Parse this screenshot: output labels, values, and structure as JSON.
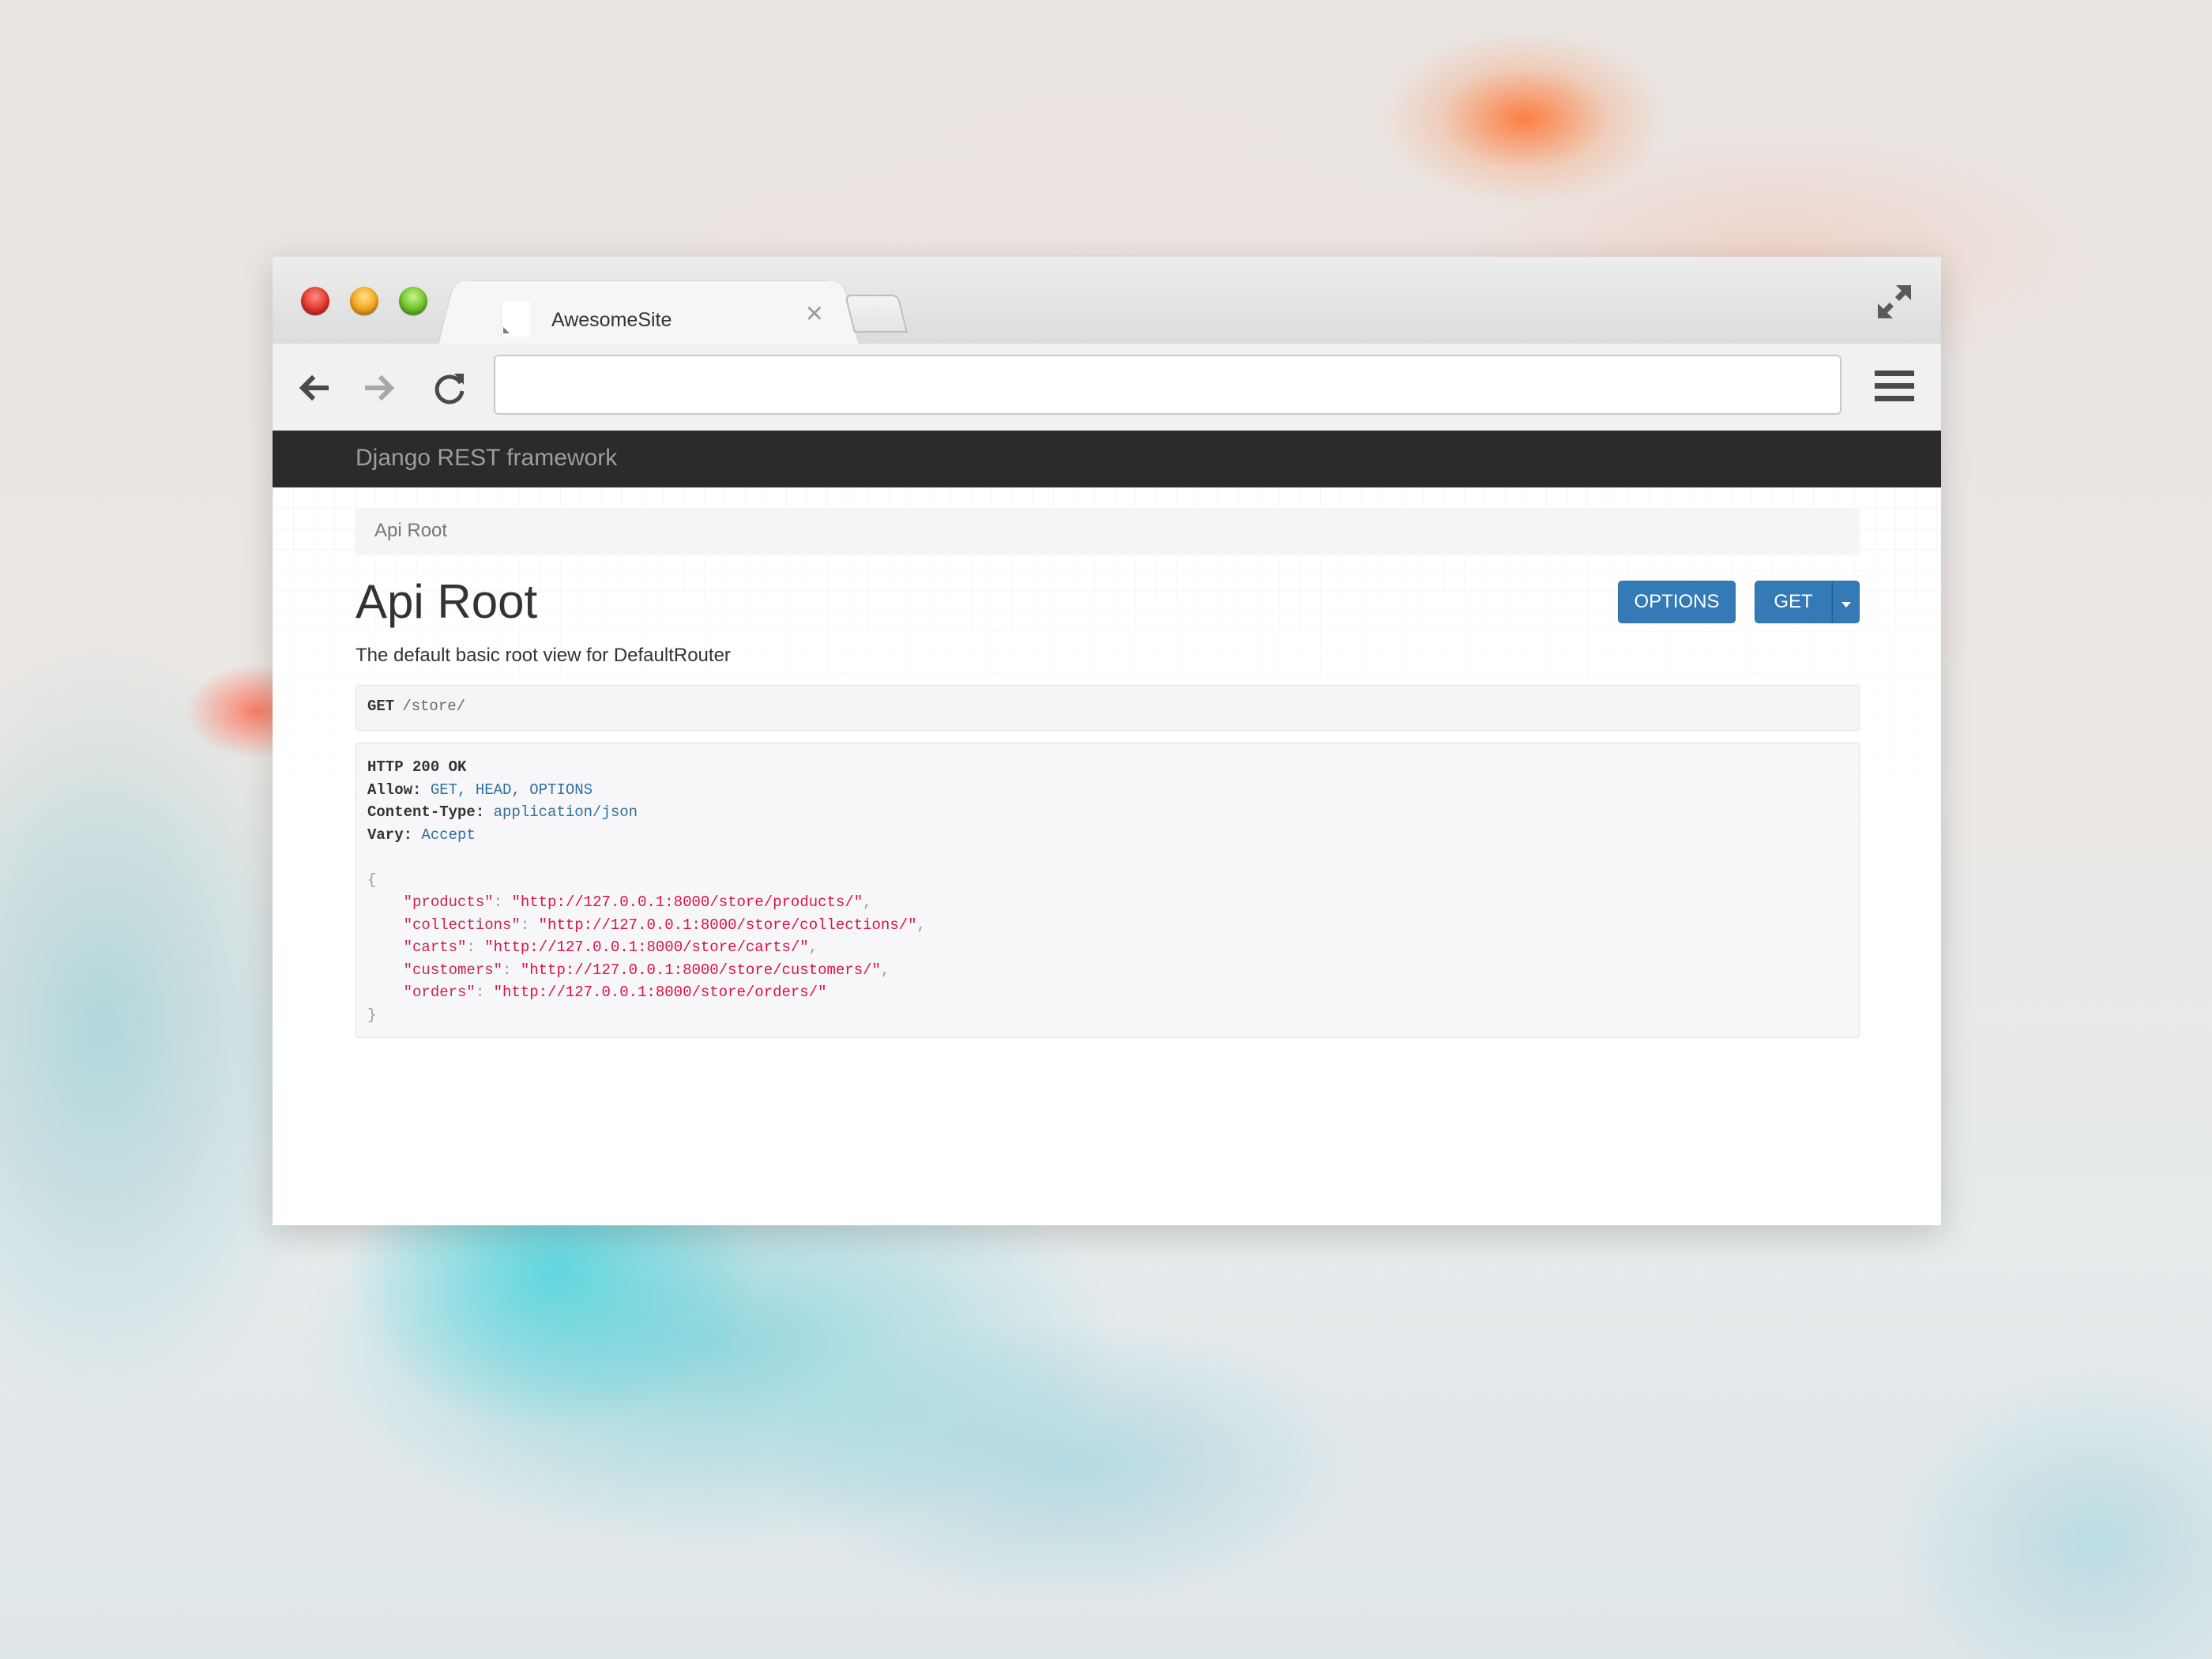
{
  "browser": {
    "tab_title": "AwesomeSite",
    "tab_close_glyph": "×",
    "address_value": "",
    "icons": [
      "close-dot",
      "minimize-dot",
      "zoom-dot",
      "fullscreen-icon",
      "back-arrow-icon",
      "forward-arrow-icon",
      "reload-icon",
      "hamburger-menu-icon"
    ]
  },
  "page": {
    "brand": "Django REST framework",
    "breadcrumb": "Api Root",
    "title": "Api Root",
    "description": "The default basic root view for DefaultRouter",
    "buttons": {
      "options": "OPTIONS",
      "get": "GET"
    },
    "request": {
      "method": "GET",
      "path": "/store/"
    },
    "response": {
      "status": "HTTP 200 OK",
      "headers": [
        {
          "key": "Allow:",
          "value": "GET, HEAD, OPTIONS"
        },
        {
          "key": "Content-Type:",
          "value": "application/json"
        },
        {
          "key": "Vary:",
          "value": "Accept"
        }
      ],
      "open_brace": "{",
      "close_brace": "}",
      "body": [
        {
          "key": "\"products\"",
          "value": "\"http://127.0.0.1:8000/store/products/\"",
          "trail": ","
        },
        {
          "key": "\"collections\"",
          "value": "\"http://127.0.0.1:8000/store/collections/\"",
          "trail": ","
        },
        {
          "key": "\"carts\"",
          "value": "\"http://127.0.0.1:8000/store/carts/\"",
          "trail": ","
        },
        {
          "key": "\"customers\"",
          "value": "\"http://127.0.0.1:8000/store/customers/\"",
          "trail": ","
        },
        {
          "key": "\"orders\"",
          "value": "\"http://127.0.0.1:8000/store/orders/\"",
          "trail": ""
        }
      ]
    }
  },
  "colors": {
    "navbar": "#2b2b2b",
    "button_primary": "#337ab7",
    "json_string": "#dd1144",
    "header_value": "#2f6f9f"
  }
}
